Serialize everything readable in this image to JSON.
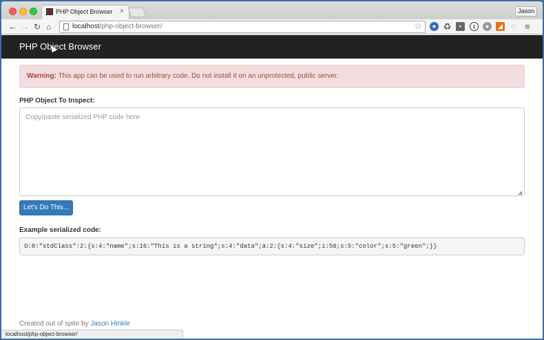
{
  "browser": {
    "tab_title": "PHP Object Browser",
    "tab_close": "×",
    "profile_name": "Jason",
    "url_host": "localhost",
    "url_path": "/php-object-browser/",
    "icons": [
      "back-arrow-icon",
      "forward-arrow-icon",
      "reload-icon",
      "home-icon",
      "page-icon",
      "star-icon",
      "menu-icon"
    ],
    "status_url": "localhost/php-object-browser/"
  },
  "navbar": {
    "brand": "PHP Object Browser"
  },
  "alert": {
    "prefix": "Warning:",
    "message": " This app can be used to run arbitrary code. Do not install it on an unprotected, public server."
  },
  "form": {
    "label": "PHP Object To Inspect:",
    "placeholder": "Copy/paste serialized PHP code here",
    "submit_label": "Let's Do This..."
  },
  "example": {
    "label": "Example serialized code:",
    "code": "O:8:\"stdClass\":2:{s:4:\"name\";s:16:\"This is a string\";s:4:\"data\";a:2:{s:4:\"size\";i:50;s:5:\"color\";s:5:\"green\";}}"
  },
  "footer": {
    "text": "Created out of spite by ",
    "author": "Jason Hinkle"
  },
  "colors": {
    "primary": "#337ab7",
    "navbar": "#222222",
    "alert_bg": "#f2dede",
    "alert_text": "#a94442"
  }
}
